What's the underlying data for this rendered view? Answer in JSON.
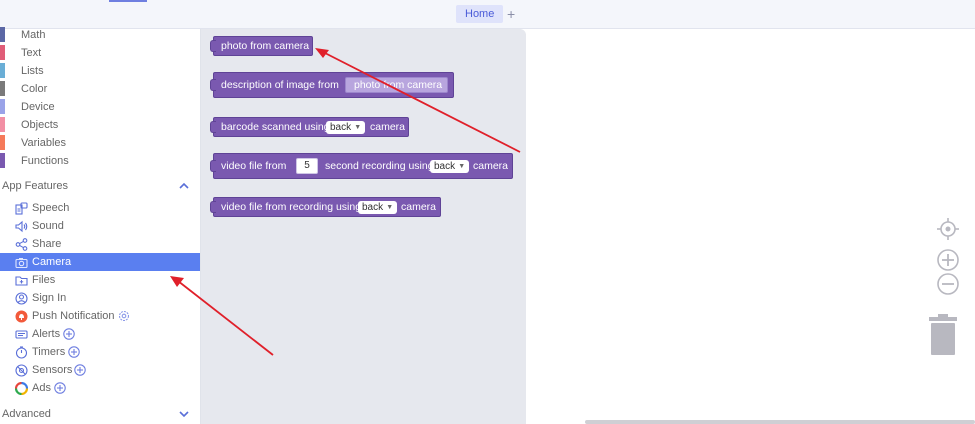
{
  "topbar": {
    "tabs": [
      {
        "label": "Home"
      }
    ],
    "add_tab_label": "+"
  },
  "sidebar": {
    "categories": [
      {
        "label": "Math",
        "color": "#5b67a5"
      },
      {
        "label": "Text",
        "color": "#e05d78"
      },
      {
        "label": "Lists",
        "color": "#6aaed6"
      },
      {
        "label": "Color",
        "color": "#7a7a7a"
      },
      {
        "label": "Device",
        "color": "#9aa3e8"
      },
      {
        "label": "Objects",
        "color": "#f28fa4"
      },
      {
        "label": "Variables",
        "color": "#f57a5a"
      },
      {
        "label": "Functions",
        "color": "#7a59b0"
      }
    ],
    "app_features_label": "App Features",
    "features": [
      {
        "label": "Speech",
        "icon": "speech-icon"
      },
      {
        "label": "Sound",
        "icon": "sound-icon"
      },
      {
        "label": "Share",
        "icon": "share-icon"
      },
      {
        "label": "Camera",
        "icon": "camera-icon",
        "selected": true
      },
      {
        "label": "Files",
        "icon": "files-icon"
      },
      {
        "label": "Sign In",
        "icon": "sign-in-icon"
      },
      {
        "label": "Push Notification",
        "icon": "push-notification-icon"
      },
      {
        "label": "Alerts",
        "icon": "alerts-icon"
      },
      {
        "label": "Timers",
        "icon": "timers-icon"
      },
      {
        "label": "Sensors",
        "icon": "sensors-icon"
      },
      {
        "label": "Ads",
        "icon": "ads-icon"
      }
    ],
    "advanced_label": "Advanced"
  },
  "flyout": {
    "photo_block": {
      "label": "photo from camera"
    },
    "description_block": {
      "label": "description of image from",
      "inner_label": "photo from camera"
    },
    "barcode_block": {
      "prefix": "barcode scanned using",
      "option": "back",
      "suffix": "camera"
    },
    "video_block": {
      "prefix": "video file from",
      "seconds": "5",
      "middle": "second recording using",
      "option": "back",
      "suffix": "camera"
    },
    "video_recording_block": {
      "prefix": "video file from recording using",
      "option": "back",
      "suffix": "camera"
    }
  },
  "workspace": {
    "controls": [
      "recenter-icon",
      "zoom-in-icon",
      "zoom-out-icon",
      "trash-icon"
    ]
  },
  "colors": {
    "accent": "#5a7ff0",
    "block": "#7a59b0",
    "annotation_arrow": "#e0202a"
  }
}
